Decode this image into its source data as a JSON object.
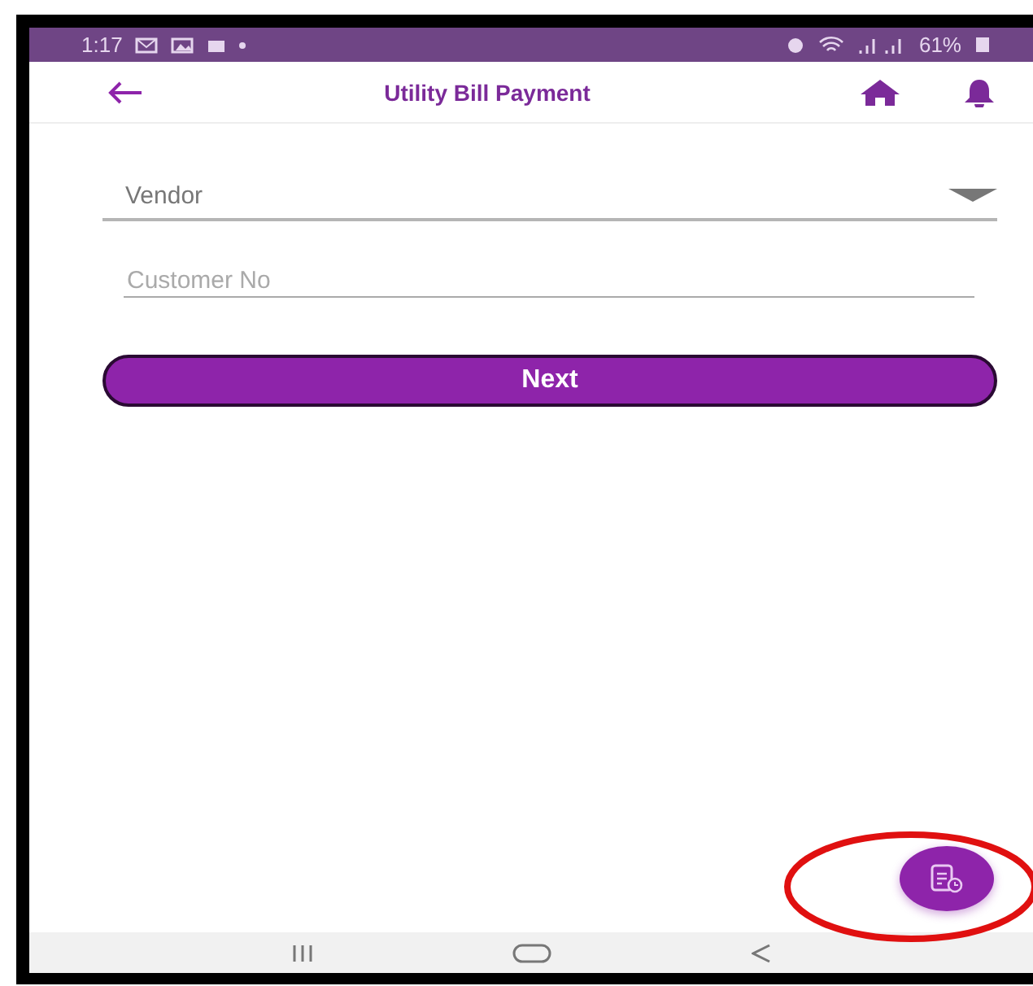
{
  "status_bar": {
    "time": "1:17",
    "battery": "61%"
  },
  "app_bar": {
    "title": "Utility Bill Payment"
  },
  "form": {
    "vendor_select": {
      "placeholder": "Vendor"
    },
    "customer_field": {
      "placeholder": "Customer No"
    },
    "next_button": {
      "label": "Next"
    }
  }
}
